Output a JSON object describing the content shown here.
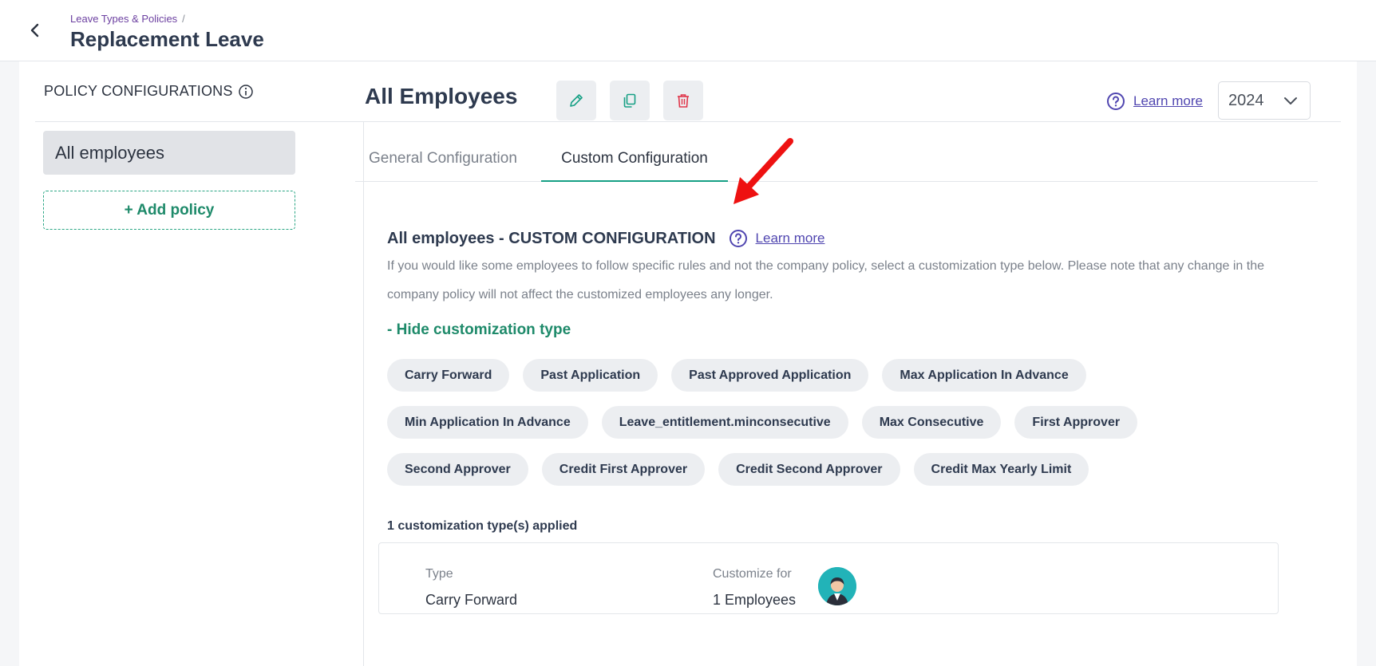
{
  "header": {
    "breadcrumb": "Leave Types & Policies",
    "breadcrumb_sep": "/",
    "title": "Replacement Leave"
  },
  "section": {
    "title": "POLICY CONFIGURATIONS"
  },
  "sidebar": {
    "policies": [
      "All employees"
    ],
    "add_policy_label": "+ Add policy"
  },
  "main": {
    "title": "All Employees",
    "learn_more": "Learn more",
    "year": "2024",
    "tabs": [
      {
        "label": "General Configuration",
        "active": false
      },
      {
        "label": "Custom Configuration",
        "active": true
      }
    ]
  },
  "custom": {
    "title": "All employees - CUSTOM CONFIGURATION",
    "learn_more": "Learn more",
    "description": "If you would like some employees to follow specific rules and not the company policy, select a customization type below. Please note that any change in the company policy will not affect the customized employees any longer.",
    "hide_label": "- Hide customization type",
    "chip_rows": [
      [
        "Carry Forward",
        "Past Application",
        "Past Approved Application",
        "Max Application In Advance"
      ],
      [
        "Min Application In Advance",
        "Leave_entitlement.minconsecutive",
        "Max Consecutive",
        "First Approver"
      ],
      [
        "Second Approver",
        "Credit First Approver",
        "Credit Second Approver",
        "Credit Max Yearly Limit"
      ]
    ],
    "applied_title": "1 customization type(s) applied",
    "applied": {
      "type_label": "Type",
      "type_value": "Carry Forward",
      "for_label": "Customize for",
      "for_value": "1 Employees"
    }
  },
  "colors": {
    "accent": "#16a085",
    "link": "#5046b0",
    "delete": "#e0354a",
    "annotation": "#ee1111"
  }
}
